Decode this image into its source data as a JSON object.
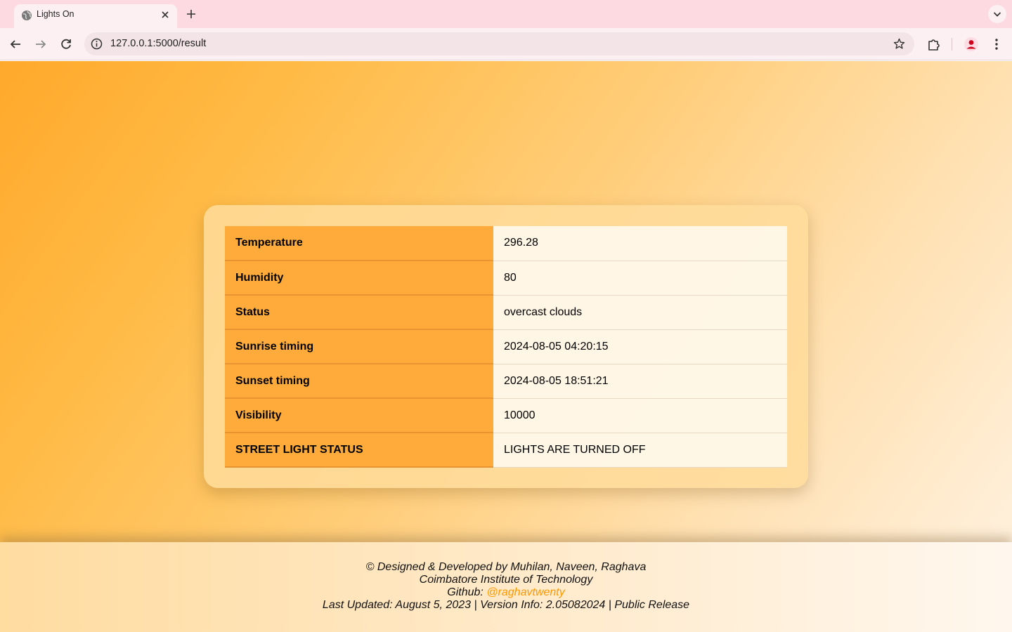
{
  "browser": {
    "tab_title": "Lights On",
    "url": "127.0.0.1:5000/result",
    "icons": [
      "globe-icon",
      "close-icon",
      "plus-icon",
      "chevron-down-icon",
      "back-arrow-icon",
      "forward-arrow-icon",
      "reload-icon",
      "info-icon",
      "star-icon",
      "extensions-icon",
      "profile-icon",
      "kebab-menu-icon"
    ]
  },
  "weather_table": {
    "rows": [
      {
        "label": "Temperature",
        "value": "296.28"
      },
      {
        "label": "Humidity",
        "value": "80"
      },
      {
        "label": "Status",
        "value": "overcast clouds"
      },
      {
        "label": "Sunrise timing",
        "value": "2024-08-05 04:20:15"
      },
      {
        "label": "Sunset timing",
        "value": "2024-08-05 18:51:21"
      },
      {
        "label": "Visibility",
        "value": "10000"
      },
      {
        "label": "STREET LIGHT STATUS",
        "value": "LIGHTS ARE TURNED OFF"
      }
    ]
  },
  "footer": {
    "credits": "© Designed & Developed by Muhilan, Naveen, Raghava",
    "institute": "Coimbatore Institute of Technology",
    "github_prefix": "Github: ",
    "github_handle": "@raghavtwenty",
    "last_updated": "Last Updated: August 5, 2023 | Version Info: 2.05082024 | Public Release"
  },
  "colors": {
    "key_cell": "#ffab3b",
    "link": "#ff9800",
    "tabstrip": "#fdd9e2"
  }
}
